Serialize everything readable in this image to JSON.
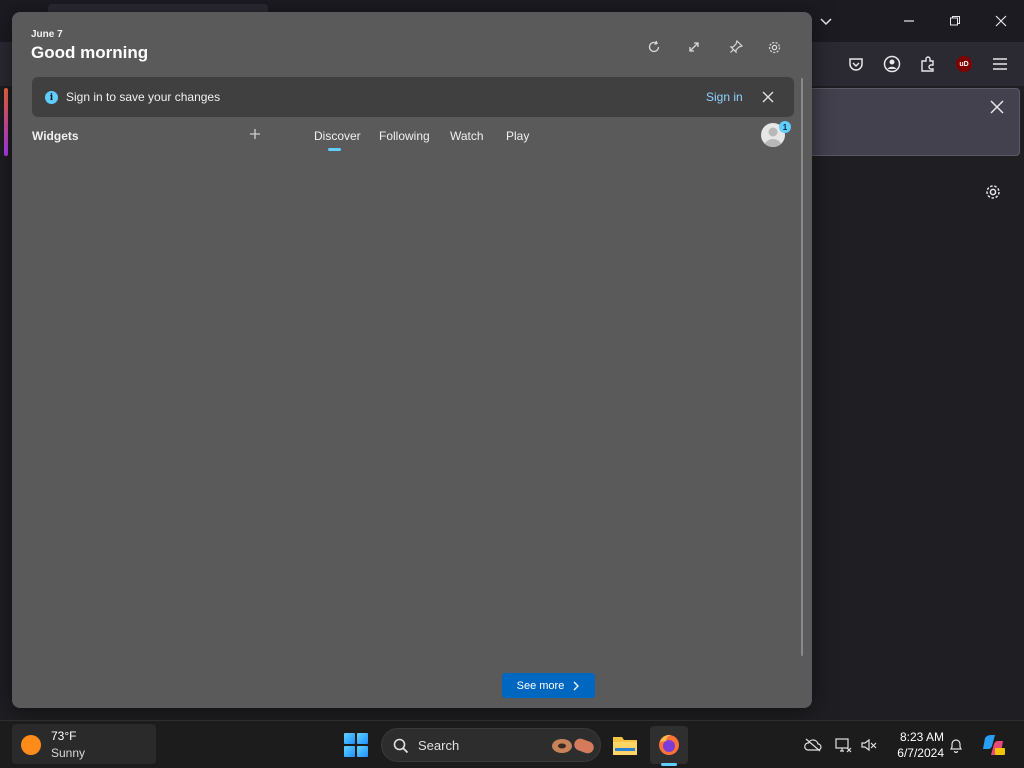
{
  "widgets": {
    "date": "June 7",
    "greeting": "Good morning",
    "signin_message": "Sign in to save your changes",
    "signin_link": "Sign in",
    "section_label": "Widgets",
    "tabs": [
      {
        "label": "Discover",
        "selected": true
      },
      {
        "label": "Following",
        "selected": false
      },
      {
        "label": "Watch",
        "selected": false
      },
      {
        "label": "Play",
        "selected": false
      }
    ],
    "avatar_badge": "1",
    "see_more_label": "See more",
    "accent_color": "#60cdff"
  },
  "taskbar": {
    "weather_temp": "73°F",
    "weather_condition": "Sunny",
    "search_label": "Search",
    "time": "8:23 AM",
    "date": "6/7/2024"
  },
  "browser": {
    "extension_badge": "uD"
  }
}
